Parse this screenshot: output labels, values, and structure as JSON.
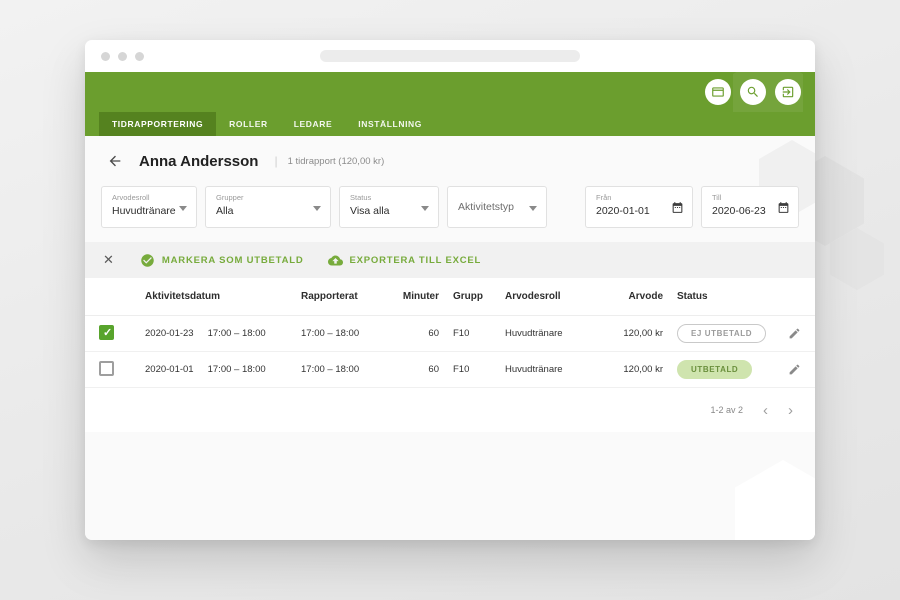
{
  "colors": {
    "green": "#6b9e2e",
    "green_dark": "#55821f",
    "paid_bg": "#cfe4ae",
    "paid_text": "#6a8f3c"
  },
  "nav": {
    "tabs": [
      {
        "label": "TIDRAPPORTERING",
        "active": true
      },
      {
        "label": "ROLLER",
        "active": false
      },
      {
        "label": "LEDARE",
        "active": false
      },
      {
        "label": "INSTÄLLNING",
        "active": false
      }
    ]
  },
  "page": {
    "title": "Anna Andersson",
    "divider": "|",
    "subtitle": "1 tidrapport (120,00 kr)"
  },
  "filters": {
    "arvodesroll": {
      "label": "Arvodesroll",
      "value": "Huvudtränare"
    },
    "grupper": {
      "label": "Grupper",
      "value": "Alla"
    },
    "status": {
      "label": "Status",
      "value": "Visa alla"
    },
    "aktivitetstyp": {
      "label": "Aktivitetstyp"
    },
    "fran": {
      "label": "Från",
      "value": "2020-01-01"
    },
    "till": {
      "label": "Till",
      "value": "2020-06-23"
    }
  },
  "toolbar": {
    "mark_paid": "MARKERA SOM UTBETALD",
    "export_excel": "EXPORTERA TILL EXCEL"
  },
  "table": {
    "headers": {
      "date": "Aktivitetsdatum",
      "reported": "Rapporterat",
      "minutes": "Minuter",
      "group": "Grupp",
      "role": "Arvodesroll",
      "fee": "Arvode",
      "status": "Status"
    },
    "rows": [
      {
        "checked": true,
        "date": "2020-01-23",
        "time": "17:00 – 18:00",
        "reported": "17:00 – 18:00",
        "minutes": "60",
        "group": "F10",
        "role": "Huvudtränare",
        "fee": "120,00 kr",
        "status": "EJ UTBETALD",
        "paid": false
      },
      {
        "checked": false,
        "date": "2020-01-01",
        "time": "17:00 – 18:00",
        "reported": "17:00 – 18:00",
        "minutes": "60",
        "group": "F10",
        "role": "Huvudtränare",
        "fee": "120,00 kr",
        "status": "UTBETALD",
        "paid": true
      }
    ],
    "pagination": "1-2 av 2"
  }
}
